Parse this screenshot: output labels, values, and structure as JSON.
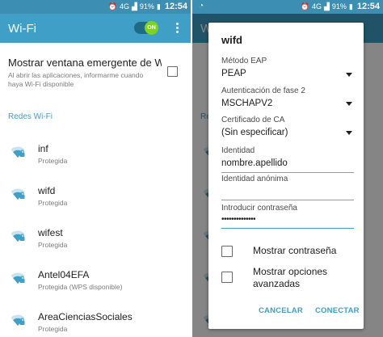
{
  "status_bar": {
    "battery": "91%",
    "time": "12:54",
    "network": "4G"
  },
  "left": {
    "app_title": "Wi-Fi",
    "toggle_label": "ON",
    "popup": {
      "title": "Mostrar ventana emergente de W...",
      "subtitle": "Al abrir las aplicaciones, informarme cuando haya Wi-Fi disponible",
      "checked": false
    },
    "section_header": "Redes Wi-Fi",
    "networks": [
      {
        "name": "inf",
        "status": "Protegida"
      },
      {
        "name": "wifd",
        "status": "Protegida"
      },
      {
        "name": "wifest",
        "status": "Protegida"
      },
      {
        "name": "Antel04EFA",
        "status": "Protegida (WPS disponible)"
      },
      {
        "name": "AreaCienciasSociales",
        "status": "Protegida"
      }
    ]
  },
  "right": {
    "bg_labels": {
      "short_title": "W",
      "section": "Re"
    },
    "dialog": {
      "title": "wifd",
      "eap_label": "Método EAP",
      "eap_value": "PEAP",
      "phase2_label": "Autenticación de fase 2",
      "phase2_value": "MSCHAPV2",
      "ca_label": "Certificado de CA",
      "ca_value": "(Sin especificar)",
      "identity_label": "Identidad",
      "identity_value": "nombre.apellido",
      "anon_label": "Identidad anónima",
      "password_label": "Introducir contraseña",
      "password_value": "••••••••••••••",
      "show_password_label": "Mostrar contraseña",
      "show_advanced_label_1": "Mostrar opciones",
      "show_advanced_label_2": "avanzadas",
      "cancel": "CANCELAR",
      "connect": "CONECTAR"
    }
  },
  "colors": {
    "accent": "#3f9fc6",
    "statusbar": "#3c8fb3",
    "toggle_on": "#7ed321"
  }
}
